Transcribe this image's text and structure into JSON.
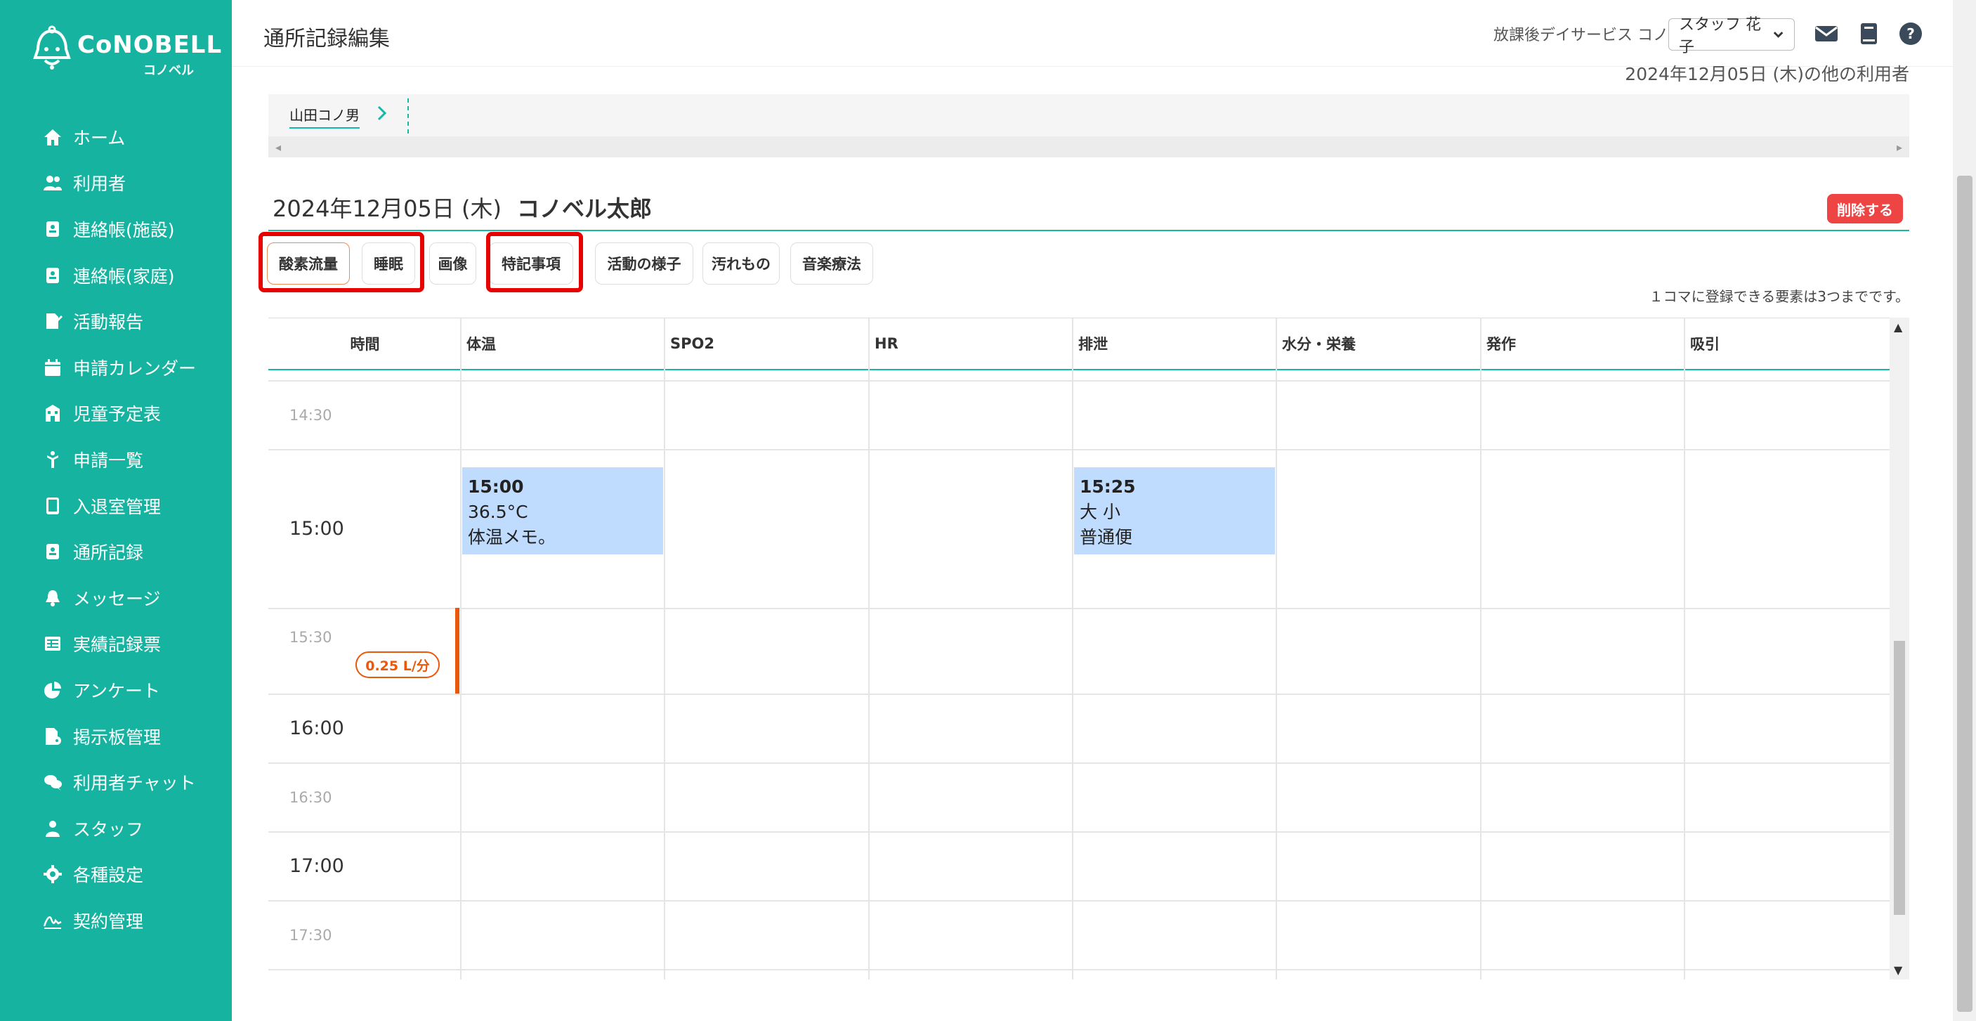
{
  "app": {
    "brand": "CoNOBELL",
    "brand_sub": "コノベル"
  },
  "sidebar": {
    "items": [
      {
        "label": "ホーム",
        "icon": "home-icon"
      },
      {
        "label": "利用者",
        "icon": "users-icon"
      },
      {
        "label": "連絡帳(施設)",
        "icon": "contact-book-icon"
      },
      {
        "label": "連絡帳(家庭)",
        "icon": "contact-book-icon"
      },
      {
        "label": "活動報告",
        "icon": "report-edit-icon"
      },
      {
        "label": "申請カレンダー",
        "icon": "calendar-icon"
      },
      {
        "label": "児童予定表",
        "icon": "school-icon"
      },
      {
        "label": "申請一覧",
        "icon": "child-icon"
      },
      {
        "label": "入退室管理",
        "icon": "tablet-icon"
      },
      {
        "label": "通所記録",
        "icon": "contact-book-icon"
      },
      {
        "label": "メッセージ",
        "icon": "bell-icon"
      },
      {
        "label": "実績記録票",
        "icon": "table-icon"
      },
      {
        "label": "アンケート",
        "icon": "pie-chart-icon"
      },
      {
        "label": "掲示板管理",
        "icon": "board-settings-icon"
      },
      {
        "label": "利用者チャット",
        "icon": "chat-icon"
      },
      {
        "label": "スタッフ",
        "icon": "staff-icon"
      },
      {
        "label": "各種設定",
        "icon": "gear-icon"
      },
      {
        "label": "契約管理",
        "icon": "signature-icon"
      }
    ]
  },
  "header": {
    "title": "通所記録編集",
    "facility": "放課後デイサービス コノベル",
    "staff_select": "スタッフ 花子",
    "icons": [
      "mail-icon",
      "book-icon",
      "help-icon"
    ]
  },
  "other_users_link": "2024年12月05日 (木)の他の利用者",
  "user_strip": {
    "user": "山田コノ男"
  },
  "record": {
    "date": "2024年12月05日 (木)",
    "child": "コノベル太郎",
    "delete_label": "削除する"
  },
  "tabs": [
    {
      "label": "酸素流量",
      "active": true
    },
    {
      "label": "睡眠",
      "active": false
    },
    {
      "label": "画像",
      "active": false
    },
    {
      "label": "特記事項",
      "active": false
    },
    {
      "label": "活動の様子",
      "active": false
    },
    {
      "label": "汚れもの",
      "active": false
    },
    {
      "label": "音楽療法",
      "active": false
    }
  ],
  "max_note": "１コマに登録できる要素は3つまでです。",
  "grid": {
    "columns": [
      "時間",
      "体温",
      "SPO2",
      "HR",
      "排泄",
      "水分・栄養",
      "発作",
      "吸引"
    ],
    "times": [
      "14:30",
      "15:00",
      "15:30",
      "16:00",
      "16:30",
      "17:00",
      "17:30"
    ],
    "events": [
      {
        "column": "体温",
        "time": "15:00",
        "lines": [
          "36.5°C",
          "体温メモ。"
        ]
      },
      {
        "column": "排泄",
        "time": "15:25",
        "lines": [
          "大 小",
          "普通便"
        ]
      }
    ],
    "oxygen_badge": "0.25 L/分"
  },
  "colors": {
    "sidebar": "#16b4a0",
    "accent": "#14b8a6",
    "danger": "#ef4444",
    "oxygen": "#ea580c",
    "event": "#bfdbfe",
    "highlight": "#e60000"
  }
}
